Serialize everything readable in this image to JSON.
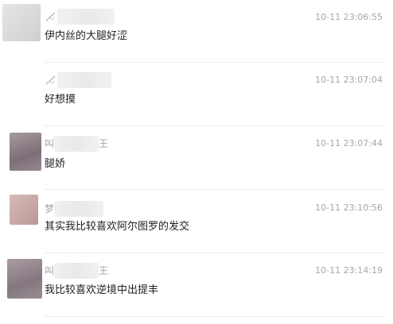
{
  "comments": [
    {
      "name_prefix": "",
      "name_suffix": "",
      "name_icon": "pen-scribble-icon",
      "time": "10-11 23:06:55",
      "text": "伊内丝的大腿好涩",
      "avatar_color": "#dcdcdc"
    },
    {
      "name_prefix": "",
      "name_suffix": "",
      "name_icon": "pen-scribble-icon",
      "time": "10-11 23:07:04",
      "text": "好想摸",
      "avatar_color": ""
    },
    {
      "name_prefix": "叫",
      "name_suffix": "王",
      "name_icon": "",
      "time": "10-11 23:07:44",
      "text": "腿娇",
      "avatar_color": "#8f7f89"
    },
    {
      "name_prefix": "梦",
      "name_suffix": "",
      "name_icon": "",
      "time": "10-11 23:10:56",
      "text": "其实我比较喜欢阿尔图罗的发交",
      "avatar_color": "#c8a9a5"
    },
    {
      "name_prefix": "叫",
      "name_suffix": "王",
      "name_icon": "",
      "time": "10-11 23:14:19",
      "text": "我比较喜欢逆境中出提丰",
      "avatar_color": "#978a92"
    }
  ]
}
